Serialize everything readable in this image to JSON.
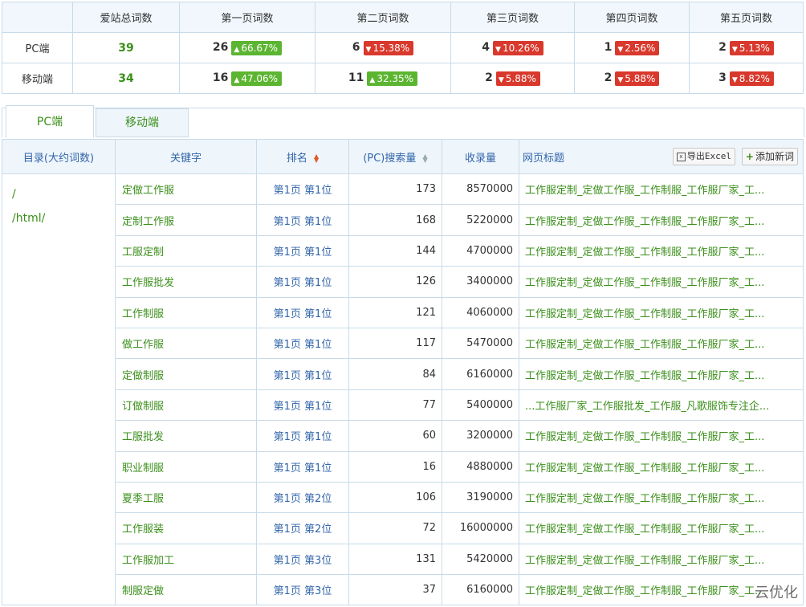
{
  "summary": {
    "headers": [
      "",
      "爱站总词数",
      "第一页词数",
      "第二页词数",
      "第三页词数",
      "第四页词数",
      "第五页词数"
    ],
    "rows": [
      {
        "label": "PC端",
        "total": "39",
        "pages": [
          {
            "count": "26",
            "dir": "up",
            "pct": "66.67%"
          },
          {
            "count": "6",
            "dir": "down",
            "pct": "15.38%"
          },
          {
            "count": "4",
            "dir": "down",
            "pct": "10.26%"
          },
          {
            "count": "1",
            "dir": "down",
            "pct": "2.56%"
          },
          {
            "count": "2",
            "dir": "down",
            "pct": "5.13%"
          }
        ]
      },
      {
        "label": "移动端",
        "total": "34",
        "pages": [
          {
            "count": "16",
            "dir": "up",
            "pct": "47.06%"
          },
          {
            "count": "11",
            "dir": "up",
            "pct": "32.35%"
          },
          {
            "count": "2",
            "dir": "down",
            "pct": "5.88%"
          },
          {
            "count": "2",
            "dir": "down",
            "pct": "5.88%"
          },
          {
            "count": "3",
            "dir": "down",
            "pct": "8.82%"
          }
        ]
      }
    ],
    "colors": {
      "up": "#5cb531",
      "down": "#d9382c",
      "total": "#3b8f1b"
    }
  },
  "tabs": [
    {
      "label": "PC端",
      "active": true
    },
    {
      "label": "移动端",
      "active": false
    }
  ],
  "table": {
    "headers": {
      "dir": "目录(大约词数)",
      "keyword": "关键字",
      "rank": "排名",
      "volume": "(PC)搜索量",
      "indexed": "收录量",
      "title": "网页标题"
    },
    "export_label": "导出Excel",
    "add_label": "添加新词",
    "dirs": [
      "/",
      "/html/"
    ],
    "rows": [
      {
        "kw": "定做工作服",
        "rank": "第1页 第1位",
        "vol": "173",
        "idx": "8570000",
        "title": "工作服定制_定做工作服_工作制服_工作服厂家_工..."
      },
      {
        "kw": "定制工作服",
        "rank": "第1页 第1位",
        "vol": "168",
        "idx": "5220000",
        "title": "工作服定制_定做工作服_工作制服_工作服厂家_工..."
      },
      {
        "kw": "工服定制",
        "rank": "第1页 第1位",
        "vol": "144",
        "idx": "4700000",
        "title": "工作服定制_定做工作服_工作制服_工作服厂家_工..."
      },
      {
        "kw": "工作服批发",
        "rank": "第1页 第1位",
        "vol": "126",
        "idx": "3400000",
        "title": "工作服定制_定做工作服_工作制服_工作服厂家_工..."
      },
      {
        "kw": "工作制服",
        "rank": "第1页 第1位",
        "vol": "121",
        "idx": "4060000",
        "title": "工作服定制_定做工作服_工作制服_工作服厂家_工..."
      },
      {
        "kw": "做工作服",
        "rank": "第1页 第1位",
        "vol": "117",
        "idx": "5470000",
        "title": "工作服定制_定做工作服_工作制服_工作服厂家_工..."
      },
      {
        "kw": "定做制服",
        "rank": "第1页 第1位",
        "vol": "84",
        "idx": "6160000",
        "title": "工作服定制_定做工作服_工作制服_工作服厂家_工..."
      },
      {
        "kw": "订做制服",
        "rank": "第1页 第1位",
        "vol": "77",
        "idx": "5400000",
        "title": "...工作服厂家_工作服批发_工作服_凡歌服饰专注企..."
      },
      {
        "kw": "工服批发",
        "rank": "第1页 第1位",
        "vol": "60",
        "idx": "3200000",
        "title": "工作服定制_定做工作服_工作制服_工作服厂家_工..."
      },
      {
        "kw": "职业制服",
        "rank": "第1页 第1位",
        "vol": "16",
        "idx": "4880000",
        "title": "工作服定制_定做工作服_工作制服_工作服厂家_工..."
      },
      {
        "kw": "夏季工服",
        "rank": "第1页 第2位",
        "vol": "106",
        "idx": "3190000",
        "title": "工作服定制_定做工作服_工作制服_工作服厂家_工..."
      },
      {
        "kw": "工作服装",
        "rank": "第1页 第2位",
        "vol": "72",
        "idx": "16000000",
        "title": "工作服定制_定做工作服_工作制服_工作服厂家_工..."
      },
      {
        "kw": "工作服加工",
        "rank": "第1页 第3位",
        "vol": "131",
        "idx": "5420000",
        "title": "工作服定制_定做工作服_工作制服_工作服厂家_工..."
      },
      {
        "kw": "制服定做",
        "rank": "第1页 第3位",
        "vol": "37",
        "idx": "6160000",
        "title": "工作服定制_定做工作服_工作制服_工作服厂家_工..."
      }
    ]
  },
  "watermark": "云优化"
}
